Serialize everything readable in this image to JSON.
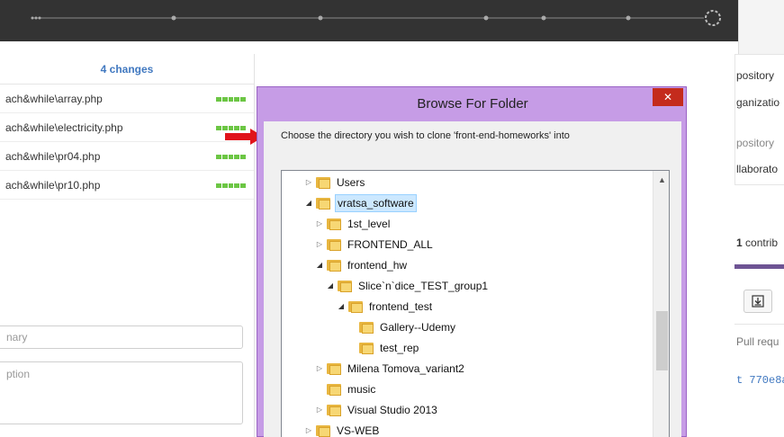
{
  "left_panel": {
    "changes_label": "4 changes",
    "files": [
      {
        "name": "ach&while\\array.php"
      },
      {
        "name": "ach&while\\electricity.php"
      },
      {
        "name": "ach&while\\pr04.php"
      },
      {
        "name": "ach&while\\pr10.php"
      }
    ],
    "summary_placeholder": "nary",
    "description_placeholder": "ption"
  },
  "right_panel": {
    "line1": "pository",
    "line2": "ganizatio",
    "line3": "pository",
    "line4": "llaborato",
    "contrib_count": "1",
    "contrib_label": " contrib",
    "clone_icon": "download-icon",
    "pull_label": "Pull requ",
    "commit_hash": "t 770e8a"
  },
  "dialog": {
    "title": "Browse For Folder",
    "close_label": "✕",
    "prompt": "Choose the directory you wish to clone 'front-end-homeworks' into",
    "tree": [
      {
        "label": "Users",
        "expander": "closed"
      },
      {
        "label": "vratsa_software",
        "expander": "open",
        "selected": true
      },
      {
        "label": "1st_level",
        "expander": "closed"
      },
      {
        "label": "FRONTEND_ALL",
        "expander": "closed"
      },
      {
        "label": "frontend_hw",
        "expander": "open"
      },
      {
        "label": "Slice`n`dice_TEST_group1",
        "expander": "open"
      },
      {
        "label": "frontend_test",
        "expander": "open"
      },
      {
        "label": "Gallery--Udemy",
        "expander": "none"
      },
      {
        "label": "test_rep",
        "expander": "none"
      },
      {
        "label": "Milena Tomova_variant2",
        "expander": "closed"
      },
      {
        "label": "music",
        "expander": "none"
      },
      {
        "label": "Visual Studio 2013",
        "expander": "closed"
      },
      {
        "label": "VS-WEB",
        "expander": "closed"
      }
    ]
  },
  "colors": {
    "topbar": "#333333",
    "dialog_frame": "#c69ce6",
    "diff_green": "#6cc644",
    "link_blue": "#4078c0",
    "close_red": "#c42b1c",
    "arrow_red": "#e0141b"
  }
}
